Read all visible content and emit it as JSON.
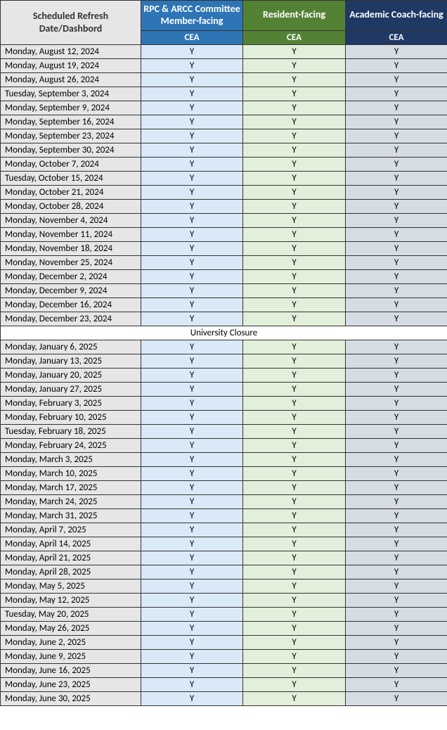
{
  "headers": {
    "date": "Scheduled Refresh Date/Dashbord",
    "col1": "RPC & ARCC Committee Member-facing",
    "col2": "Resident-facing",
    "col3": "Academic Coach-facing",
    "sub": "CEA"
  },
  "closure_label": "University Closure",
  "rows": [
    {
      "date": "Monday, August 12, 2024",
      "c1": "Y",
      "c2": "Y",
      "c3": "Y"
    },
    {
      "date": "Monday, August 19, 2024",
      "c1": "Y",
      "c2": "Y",
      "c3": "Y"
    },
    {
      "date": "Monday, August 26, 2024",
      "c1": "Y",
      "c2": "Y",
      "c3": "Y"
    },
    {
      "date": "Tuesday, September 3, 2024",
      "c1": "Y",
      "c2": "Y",
      "c3": "Y"
    },
    {
      "date": "Monday, September 9, 2024",
      "c1": "Y",
      "c2": "Y",
      "c3": "Y"
    },
    {
      "date": "Monday, September 16, 2024",
      "c1": "Y",
      "c2": "Y",
      "c3": "Y"
    },
    {
      "date": "Monday, September 23, 2024",
      "c1": "Y",
      "c2": "Y",
      "c3": "Y"
    },
    {
      "date": "Monday, September 30, 2024",
      "c1": "Y",
      "c2": "Y",
      "c3": "Y"
    },
    {
      "date": "Monday, October 7, 2024",
      "c1": "Y",
      "c2": "Y",
      "c3": "Y"
    },
    {
      "date": "Tuesday, October 15, 2024",
      "c1": "Y",
      "c2": "Y",
      "c3": "Y"
    },
    {
      "date": "Monday, October 21, 2024",
      "c1": "Y",
      "c2": "Y",
      "c3": "Y"
    },
    {
      "date": "Monday, October 28, 2024",
      "c1": "Y",
      "c2": "Y",
      "c3": "Y"
    },
    {
      "date": "Monday, November 4, 2024",
      "c1": "Y",
      "c2": "Y",
      "c3": "Y"
    },
    {
      "date": "Monday, November 11, 2024",
      "c1": "Y",
      "c2": "Y",
      "c3": "Y"
    },
    {
      "date": "Monday, November 18, 2024",
      "c1": "Y",
      "c2": "Y",
      "c3": "Y"
    },
    {
      "date": "Monday, November 25, 2024",
      "c1": "Y",
      "c2": "Y",
      "c3": "Y"
    },
    {
      "date": "Monday, December 2, 2024",
      "c1": "Y",
      "c2": "Y",
      "c3": "Y"
    },
    {
      "date": "Monday, December 9, 2024",
      "c1": "Y",
      "c2": "Y",
      "c3": "Y"
    },
    {
      "date": "Monday, December 16, 2024",
      "c1": "Y",
      "c2": "Y",
      "c3": "Y"
    },
    {
      "date": "Monday, December 23, 2024",
      "c1": "Y",
      "c2": "Y",
      "c3": "Y"
    },
    {
      "closure": true
    },
    {
      "date": "Monday, January 6, 2025",
      "c1": "Y",
      "c2": "Y",
      "c3": "Y"
    },
    {
      "date": "Monday, January 13, 2025",
      "c1": "Y",
      "c2": "Y",
      "c3": "Y"
    },
    {
      "date": "Monday, January 20, 2025",
      "c1": "Y",
      "c2": "Y",
      "c3": "Y"
    },
    {
      "date": "Monday, January 27, 2025",
      "c1": "Y",
      "c2": "Y",
      "c3": "Y"
    },
    {
      "date": "Monday, February 3, 2025",
      "c1": "Y",
      "c2": "Y",
      "c3": "Y"
    },
    {
      "date": "Monday, February 10, 2025",
      "c1": "Y",
      "c2": "Y",
      "c3": "Y"
    },
    {
      "date": "Tuesday, February 18, 2025",
      "c1": "Y",
      "c2": "Y",
      "c3": "Y"
    },
    {
      "date": "Monday, February 24, 2025",
      "c1": "Y",
      "c2": "Y",
      "c3": "Y"
    },
    {
      "date": "Monday, March 3, 2025",
      "c1": "Y",
      "c2": "Y",
      "c3": "Y"
    },
    {
      "date": "Monday, March 10, 2025",
      "c1": "Y",
      "c2": "Y",
      "c3": "Y"
    },
    {
      "date": "Monday, March 17, 2025",
      "c1": "Y",
      "c2": "Y",
      "c3": "Y"
    },
    {
      "date": "Monday, March 24, 2025",
      "c1": "Y",
      "c2": "Y",
      "c3": "Y"
    },
    {
      "date": "Monday, March 31, 2025",
      "c1": "Y",
      "c2": "Y",
      "c3": "Y"
    },
    {
      "date": "Monday, April 7, 2025",
      "c1": "Y",
      "c2": "Y",
      "c3": "Y"
    },
    {
      "date": "Monday, April 14, 2025",
      "c1": "Y",
      "c2": "Y",
      "c3": "Y"
    },
    {
      "date": "Monday, April 21, 2025",
      "c1": "Y",
      "c2": "Y",
      "c3": "Y"
    },
    {
      "date": "Monday, April 28, 2025",
      "c1": "Y",
      "c2": "Y",
      "c3": "Y"
    },
    {
      "date": "Monday, May 5, 2025",
      "c1": "Y",
      "c2": "Y",
      "c3": "Y"
    },
    {
      "date": "Monday, May 12, 2025",
      "c1": "Y",
      "c2": "Y",
      "c3": "Y"
    },
    {
      "date": "Tuesday, May 20, 2025",
      "c1": "Y",
      "c2": "Y",
      "c3": "Y"
    },
    {
      "date": "Monday, May 26, 2025",
      "c1": "Y",
      "c2": "Y",
      "c3": "Y"
    },
    {
      "date": "Monday, June 2, 2025",
      "c1": "Y",
      "c2": "Y",
      "c3": "Y"
    },
    {
      "date": "Monday, June 9, 2025",
      "c1": "Y",
      "c2": "Y",
      "c3": "Y"
    },
    {
      "date": "Monday, June 16, 2025",
      "c1": "Y",
      "c2": "Y",
      "c3": "Y"
    },
    {
      "date": "Monday, June 23, 2025",
      "c1": "Y",
      "c2": "Y",
      "c3": "Y"
    },
    {
      "date": "Monday, June 30, 2025",
      "c1": "Y",
      "c2": "Y",
      "c3": "Y"
    }
  ]
}
